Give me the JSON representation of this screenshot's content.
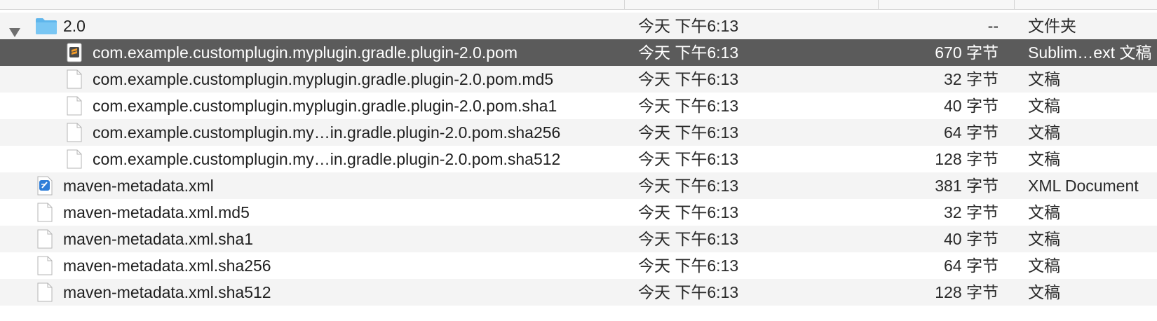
{
  "rows": [
    {
      "name": "2.0",
      "date": "今天 下午6:13",
      "size": "--",
      "kind": "文件夹",
      "icon": "folder-icon"
    },
    {
      "name": "com.example.customplugin.myplugin.gradle.plugin-2.0.pom",
      "date": "今天 下午6:13",
      "size": "670 字节",
      "kind": "Sublim…ext 文稿",
      "icon": "sublime-document-icon"
    },
    {
      "name": "com.example.customplugin.myplugin.gradle.plugin-2.0.pom.md5",
      "date": "今天 下午6:13",
      "size": "32 字节",
      "kind": "文稿",
      "icon": "document-icon"
    },
    {
      "name": "com.example.customplugin.myplugin.gradle.plugin-2.0.pom.sha1",
      "date": "今天 下午6:13",
      "size": "40 字节",
      "kind": "文稿",
      "icon": "document-icon"
    },
    {
      "name": "com.example.customplugin.my…in.gradle.plugin-2.0.pom.sha256",
      "date": "今天 下午6:13",
      "size": "64 字节",
      "kind": "文稿",
      "icon": "document-icon"
    },
    {
      "name": "com.example.customplugin.my…in.gradle.plugin-2.0.pom.sha512",
      "date": "今天 下午6:13",
      "size": "128 字节",
      "kind": "文稿",
      "icon": "document-icon"
    },
    {
      "name": "maven-metadata.xml",
      "date": "今天 下午6:13",
      "size": "381 字节",
      "kind": "XML Document",
      "icon": "xml-document-icon"
    },
    {
      "name": "maven-metadata.xml.md5",
      "date": "今天 下午6:13",
      "size": "32 字节",
      "kind": "文稿",
      "icon": "document-icon"
    },
    {
      "name": "maven-metadata.xml.sha1",
      "date": "今天 下午6:13",
      "size": "40 字节",
      "kind": "文稿",
      "icon": "document-icon"
    },
    {
      "name": "maven-metadata.xml.sha256",
      "date": "今天 下午6:13",
      "size": "64 字节",
      "kind": "文稿",
      "icon": "document-icon"
    },
    {
      "name": "maven-metadata.xml.sha512",
      "date": "今天 下午6:13",
      "size": "128 字节",
      "kind": "文稿",
      "icon": "document-icon"
    }
  ],
  "colors": {
    "selected_row": "#5b5b5b",
    "alt_row": "#f4f4f4",
    "folder_blue": "#5fb6ec"
  }
}
